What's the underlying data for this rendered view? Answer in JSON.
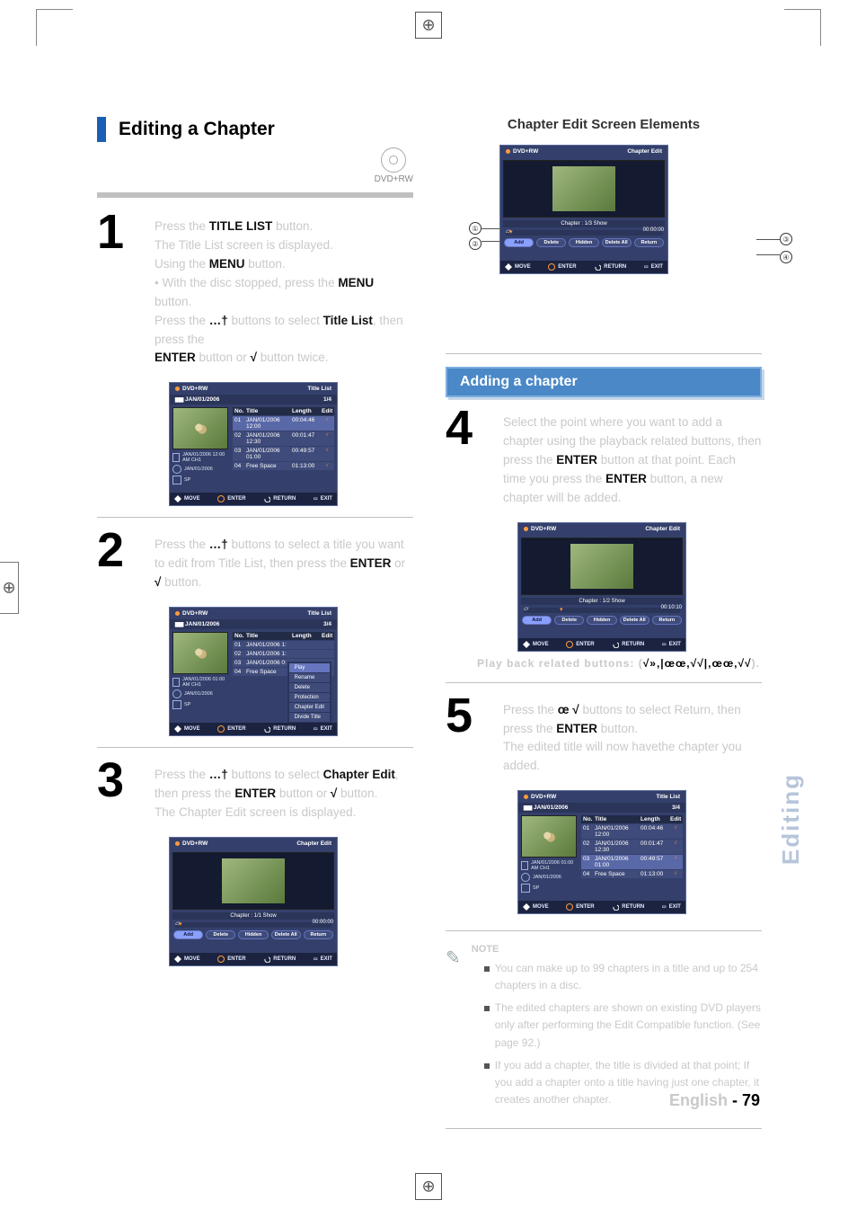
{
  "section_title": "Editing a Chapter",
  "disc_badge": "DVD+RW",
  "rightcol": {
    "elements_title": "Chapter Edit Screen Elements",
    "banner": "Adding a chapter",
    "play_symbols": "√»,|œœ,√√|,œœ,√√"
  },
  "steps": {
    "s1": {
      "num": "1",
      "line_a": "Press the ",
      "bold_a": "TITLE LIST",
      "line_b": " button.",
      "sub1": "The Title List screen is displayed.",
      "menu_hint_a": "Using the ",
      "menu1": "MENU",
      "menu_hint_b": " button.",
      "bullet": "• With the disc stopped, press the ",
      "menu2": "MENU",
      "bullet_b": " button.",
      "arrows_a": "Press the ",
      "arrows_sym": "…†",
      "arrows_b": " buttons to select ",
      "titlelist": "Title List",
      "arrows_c": ", then press the ",
      "enter": "ENTER",
      "arrows_d": " button or ",
      "right_sym": "√",
      "arrows_e": " button twice."
    },
    "s2": {
      "num": "2",
      "a": "Press the ",
      "sym": "…†",
      "b": " buttons to select a title you want to edit from Title List, then press the ",
      "enter": "ENTER",
      "c": " or ",
      "rsym": "√",
      "d": " button."
    },
    "s3": {
      "num": "3",
      "a": "Press the ",
      "sym": "…†",
      "b": " buttons to select ",
      "ce": "Chapter Edit",
      "c": ", then press the ",
      "enter": "ENTER",
      "d": " button or ",
      "rsym": "√",
      "e": " button.",
      "tail": "The Chapter Edit screen is displayed."
    },
    "s4": {
      "num": "4",
      "a": "Select the point where you want to add a chapter using the playback related buttons, then press the ",
      "enter": "ENTER",
      "b": " button at that point. Each time you press the ",
      "enter2": "ENTER",
      "c": " button, a new chapter will be added.",
      "sub": "Play back related buttons: (",
      "subsym": "√»,|œœ,√√|,œœ,√√",
      "sub_end": ")."
    },
    "s5": {
      "num": "5",
      "a": "Press the ",
      "sym": "œ √",
      "b": " buttons to select Return, then press the ",
      "enter": "ENTER",
      "c": " button.",
      "tail": "The edited title will now havethe chapter you added."
    }
  },
  "callout_nums": [
    "①",
    "②",
    "③",
    "④"
  ],
  "panel_common": {
    "dvdrw": "DVD+RW",
    "move": "MOVE",
    "enter": "ENTER",
    "return": "RETURN",
    "exit": "EXIT"
  },
  "panel_titlelist": {
    "title": "Title List",
    "date": "JAN/01/2006",
    "counter_a": "1/4",
    "counter_b": "3/4",
    "hdr": {
      "no": "No.",
      "title": "Title",
      "len": "Length",
      "edit": "Edit"
    },
    "rows": [
      {
        "no": "01",
        "title": "JAN/01/2006  12:00",
        "len": "00:04:46"
      },
      {
        "no": "02",
        "title": "JAN/01/2006  12:30",
        "len": "00:01:47"
      },
      {
        "no": "03",
        "title": "JAN/01/2006  01:00",
        "len": "00:49:57"
      },
      {
        "no": "04",
        "title": "Free Space",
        "len": "01:13:00"
      }
    ],
    "meta1": "JAN/01/2006 12:00 AM CH1",
    "meta1_b": "JAN/01/2006 01:00 AM CH1",
    "meta2": "JAN/01/2006",
    "meta3": "SP"
  },
  "panel_titlelist_popup": {
    "rows_short": [
      {
        "no": "01",
        "title": "JAN/01/2006  1:",
        "extra": "Play"
      },
      {
        "no": "02",
        "title": "JAN/01/2006  1:",
        "extra": "Rename"
      },
      {
        "no": "03",
        "title": "JAN/01/2006  0:",
        "extra": "Delete"
      },
      {
        "no": "04",
        "title": "Free Space",
        "extra": "Protection"
      }
    ],
    "more": [
      "Chapter Edit",
      "Divide Title"
    ]
  },
  "panel_ce": {
    "title": "Chapter Edit",
    "chapinfo": "Chapter : 1/1 Show",
    "chapinfo2": "Chapter : 1/2 Show",
    "chapinfo3": "Chapter : 1/3 Show",
    "time0": "00:00:00",
    "time1": "00:10:10",
    "pills": [
      "Add",
      "Delete",
      "Hidden",
      "Delete All",
      "Return"
    ]
  },
  "notes": {
    "label": "NOTE",
    "items": [
      "You can make up to 99 chapters in a title and up to 254 chapters in a disc.",
      "The edited chapters are shown on existing DVD players only after performing the Edit Compatible function. (See page 92.)",
      "If you add a chapter, the title is divided at that point; If you add a chapter onto a title having just one chapter, it creates another chapter."
    ]
  },
  "sidetab": "Editing",
  "page_no_a": "English ",
  "page_no_b": "- 79"
}
